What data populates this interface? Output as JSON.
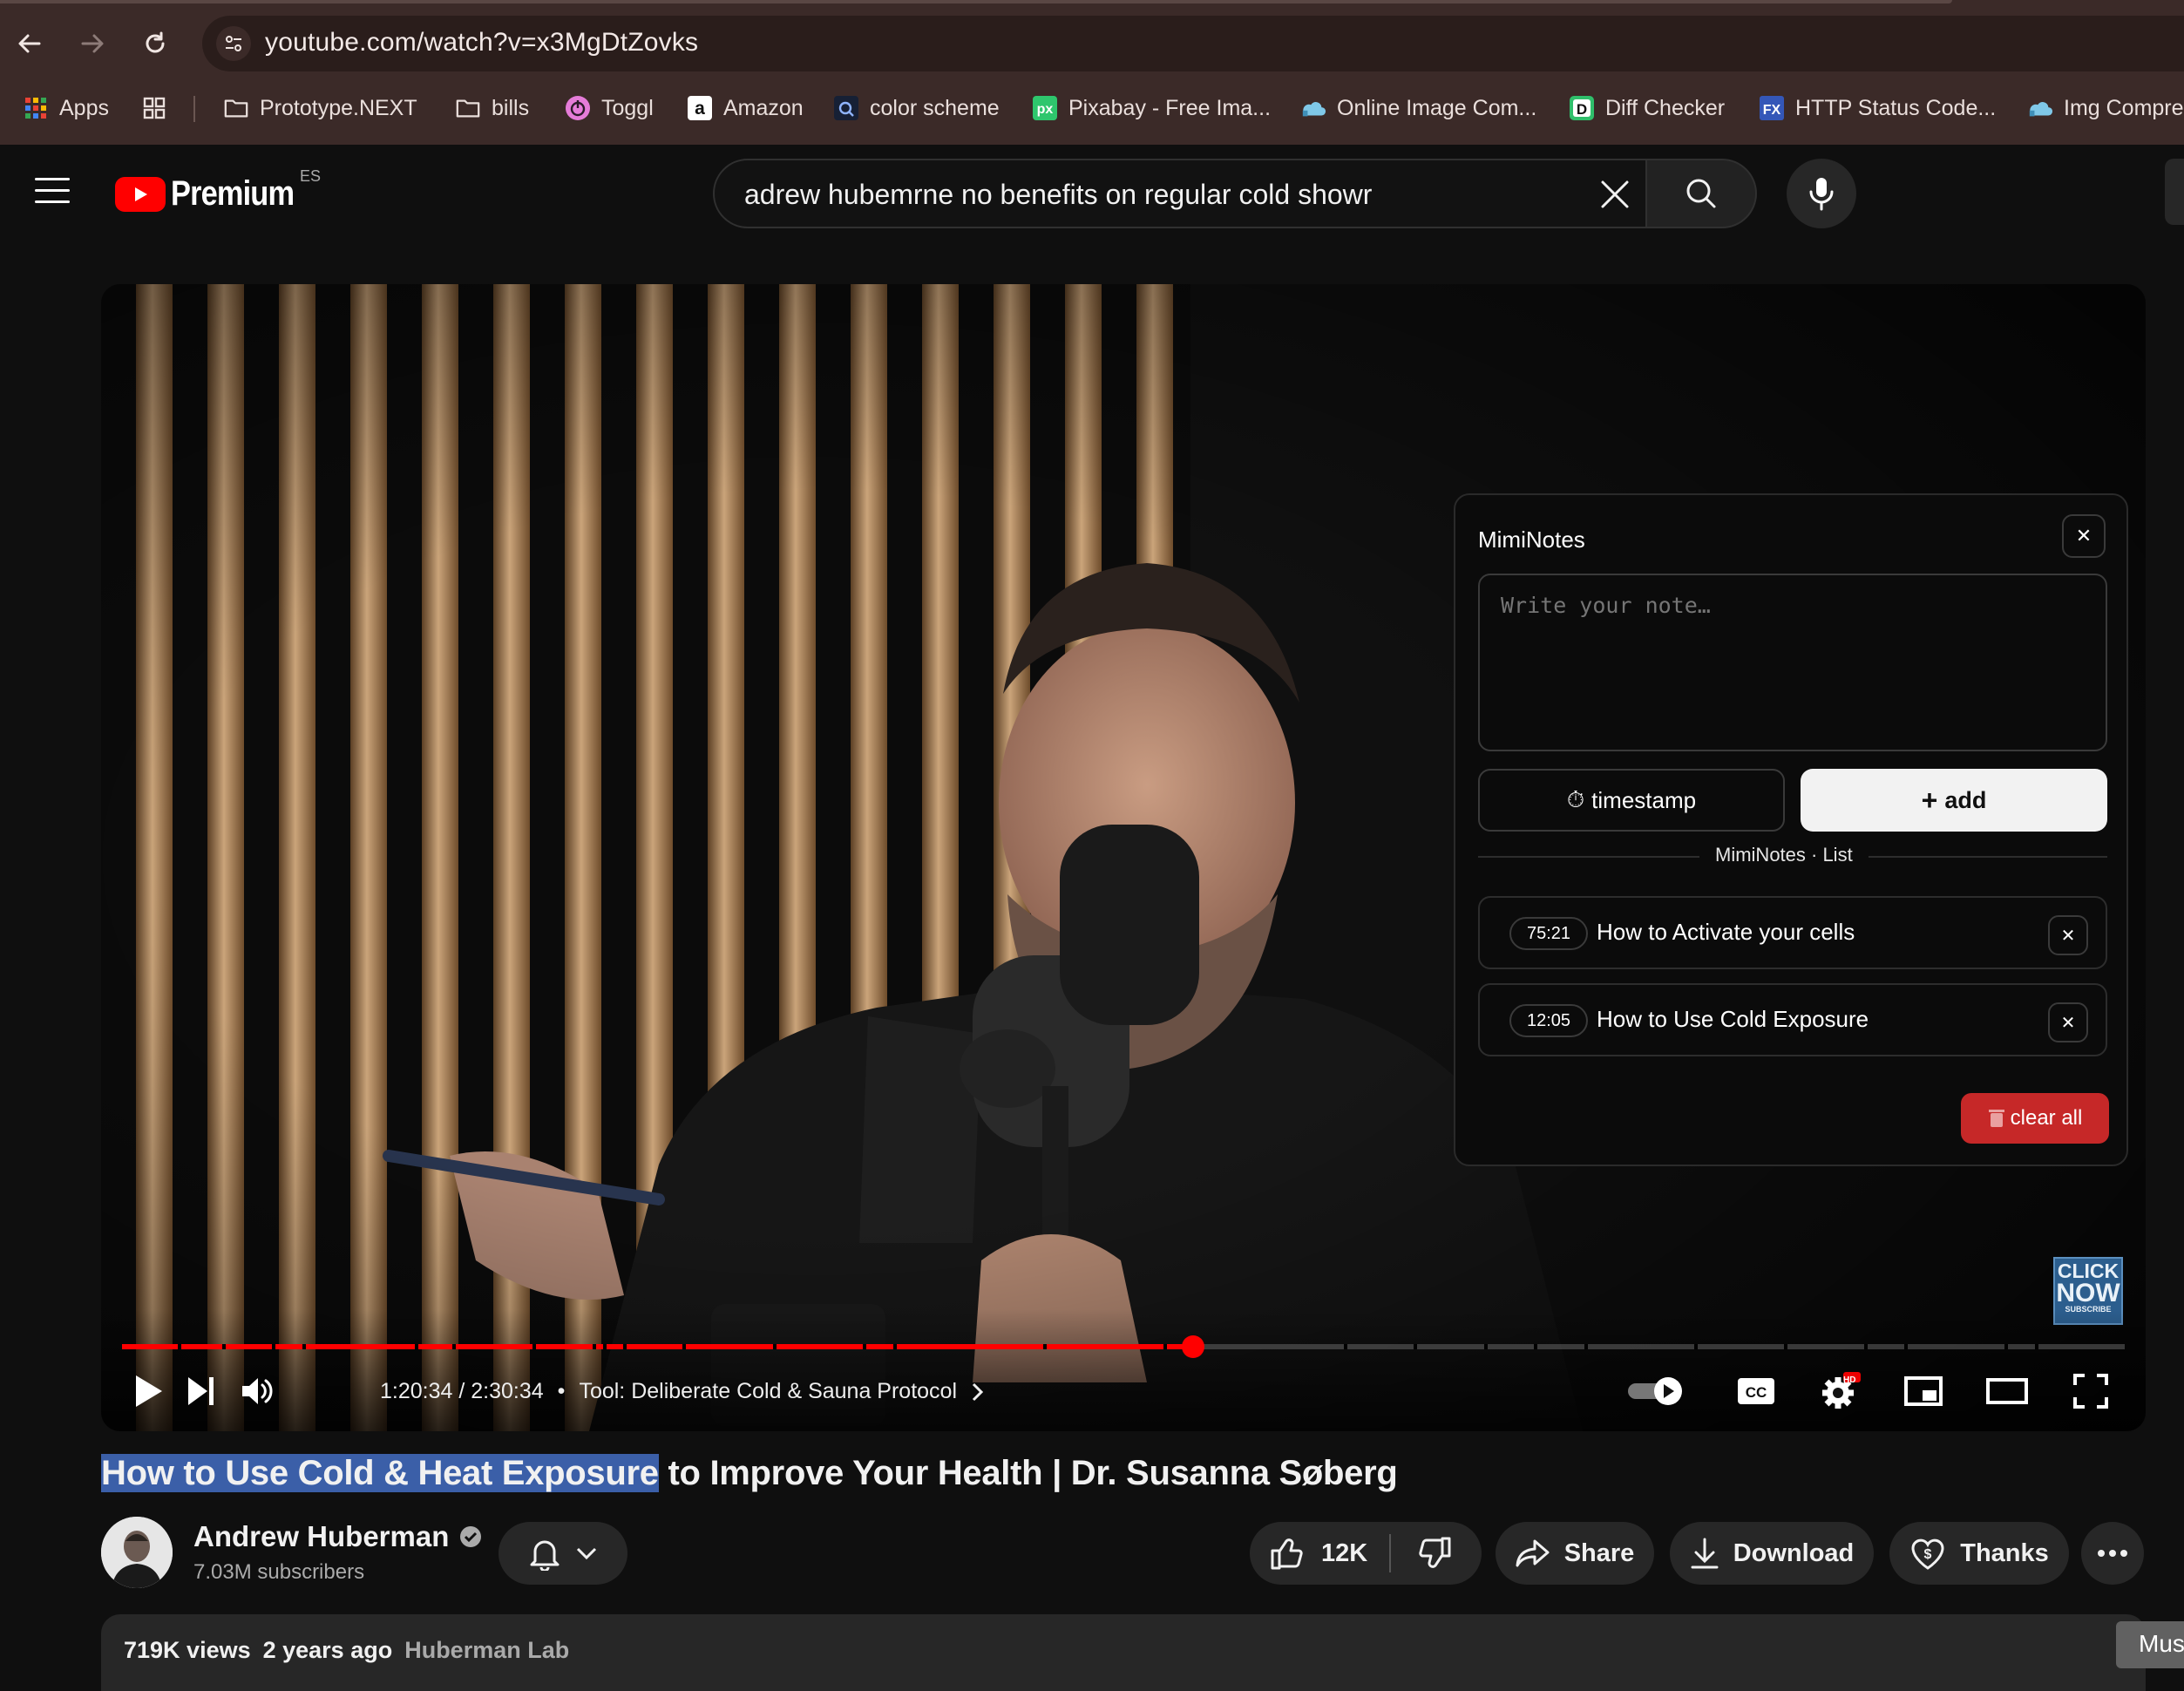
{
  "browser": {
    "url": "youtube.com/watch?v=x3MgDtZovks",
    "bookmarks": [
      {
        "label": "Apps",
        "icon": "apps-grid-icon"
      },
      {
        "label": "",
        "icon": "tab-groups-icon"
      },
      {
        "label": "Prototype.NEXT",
        "icon": "folder-icon"
      },
      {
        "label": "bills",
        "icon": "folder-icon"
      },
      {
        "label": "Toggl",
        "icon": "toggl-icon"
      },
      {
        "label": "Amazon",
        "icon": "amazon-icon"
      },
      {
        "label": "color scheme",
        "icon": "color-scheme-icon"
      },
      {
        "label": "Pixabay - Free Ima...",
        "icon": "pixabay-icon"
      },
      {
        "label": "Online Image Com...",
        "icon": "cloud-icon"
      },
      {
        "label": "Diff Checker",
        "icon": "diffchecker-icon"
      },
      {
        "label": "HTTP Status Code...",
        "icon": "fx-icon"
      },
      {
        "label": "Img Compre",
        "icon": "cloud-icon"
      }
    ]
  },
  "header": {
    "logo_text": "Premium",
    "region": "ES",
    "search_query": "adrew hubemrne no benefits on regular cold showr"
  },
  "player": {
    "time": "1:20:34 / 2:30:34",
    "bullet": "•",
    "chapter": "Tool: Deliberate Cold & Sauna Protocol",
    "progress_fraction": 0.535,
    "hd_badge": "HD",
    "overlay": {
      "line1": "CLICK",
      "line2": "NOW",
      "line3": "SUBSCRIBE"
    }
  },
  "miminotes": {
    "title": "MimiNotes",
    "placeholder": "Write your note…",
    "timestamp_label": "timestamp",
    "add_label": "add",
    "list_label": "MimiNotes · List",
    "notes": [
      {
        "time": "75:21",
        "text": "How to Activate your cells"
      },
      {
        "time": "12:05",
        "text": "How to Use Cold Exposure"
      }
    ],
    "clear_label": "clear all"
  },
  "video": {
    "title_highlight": "How to Use Cold & Heat Exposure",
    "title_rest": " to Improve Your Health | Dr. Susanna Søberg",
    "channel": "Andrew Huberman",
    "subscribers": "7.03M subscribers",
    "likes": "12K",
    "share_label": "Share",
    "download_label": "Download",
    "thanks_label": "Thanks",
    "views": "719K views",
    "age": "2 years ago",
    "tag": "Huberman Lab"
  },
  "tooltip": "Mus",
  "colors": {
    "accent": "#ff0000",
    "highlight": "#3b5fa8",
    "clear": "#c62828"
  }
}
